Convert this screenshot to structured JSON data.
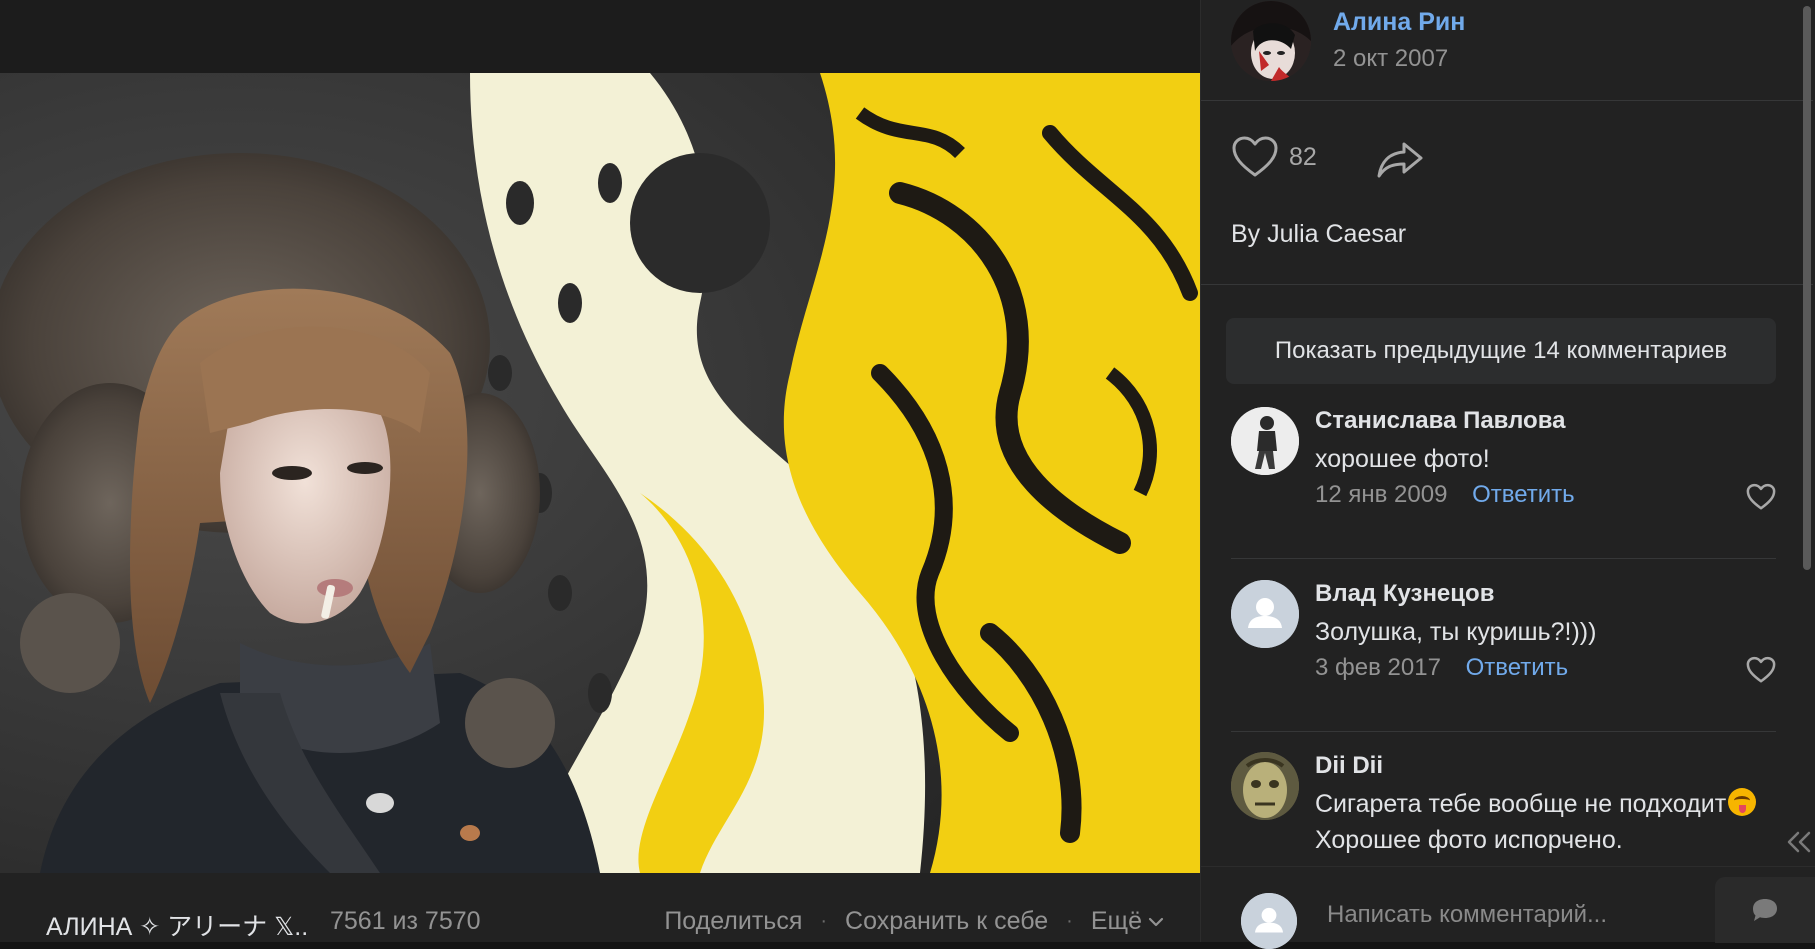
{
  "photo": {
    "album_name": "АЛИНА ✧ アリーナ 𝕏..",
    "counter": "7561 из 7570",
    "actions": {
      "share": "Поделиться",
      "save": "Сохранить к себе",
      "more": "Ещё"
    },
    "separator": "·"
  },
  "post": {
    "author_name": "Алина Рин",
    "date": "2 окт 2007",
    "likes": "82",
    "caption": "By Julia Caesar"
  },
  "comments": {
    "show_previous": "Показать предыдущие 14 комментариев",
    "items": [
      {
        "name": "Станислава Павлова",
        "text": "хорошее фото!",
        "date": "12 янв 2009",
        "reply": "Ответить"
      },
      {
        "name": "Влад Кузнецов",
        "text": "Золушка, ты куришь?!)))",
        "date": "3 фев 2017",
        "reply": "Ответить"
      },
      {
        "name": "Dii Dii",
        "text_line1": "Сигарета тебе вообще не подходит",
        "text_line2": "Хорошее фото испорчено."
      }
    ]
  },
  "composer": {
    "placeholder": "Написать комментарий..."
  },
  "icons": {
    "like": "heart-icon",
    "share": "share-arrow-icon",
    "comment_like": "heart-outline-icon",
    "more": "chevron-down-icon",
    "send": "speech-bubble-icon",
    "collapse": "double-chevron-left-icon",
    "emoji": "squinting-face-with-tongue-icon"
  },
  "colors": {
    "link": "#71aaeb",
    "background": "#222222",
    "text": "#e1e3e6",
    "secondary_text": "#939393"
  }
}
